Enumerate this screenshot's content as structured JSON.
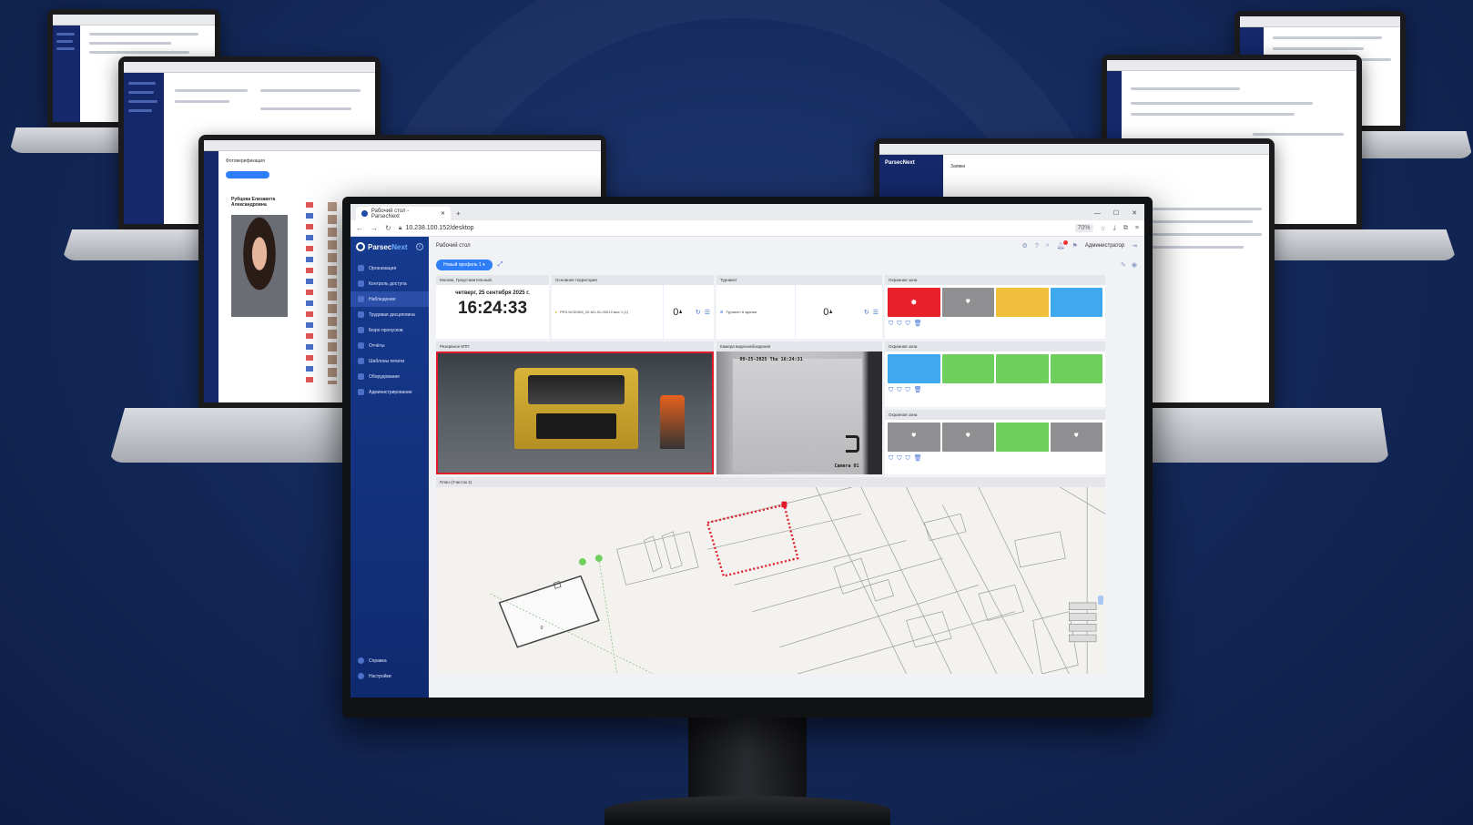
{
  "browser": {
    "tab_title": "Рабочий стол - ParsecNext",
    "url": "10.238.100.152/desktop",
    "zoom": "70%"
  },
  "app": {
    "brand_parsec": "Parsec",
    "brand_next": "Next",
    "page_title": "Рабочий стол",
    "user": "Администратор",
    "profile_label": "Новый профиль 1",
    "nav": [
      {
        "label": "Организация",
        "icon": "org-icon"
      },
      {
        "label": "Контроль доступа",
        "icon": "access-icon"
      },
      {
        "label": "Наблюдение",
        "icon": "eye-icon",
        "active": true
      },
      {
        "label": "Трудовая дисциплина",
        "icon": "worker-icon"
      },
      {
        "label": "Бюро пропусков",
        "icon": "pass-icon"
      },
      {
        "label": "Отчёты",
        "icon": "report-icon"
      },
      {
        "label": "Шаблоны печати",
        "icon": "print-icon"
      },
      {
        "label": "Оборудование",
        "icon": "hardware-icon"
      },
      {
        "label": "Администрирование",
        "icon": "admin-icon"
      }
    ],
    "nav_bottom": [
      {
        "label": "Справка",
        "icon": "help-icon"
      },
      {
        "label": "Настройки",
        "icon": "settings-icon"
      }
    ]
  },
  "widgets": {
    "clock": {
      "title": "Москва, Гредставительный.",
      "date": "четверг, 25 сентября 2025 г.",
      "time": "16:24:33"
    },
    "territory": {
      "title": "Основная территория",
      "device": "PRS.NC60KM_0Z-M1-01-00013 вых 1 (1)",
      "count": "0"
    },
    "turnstile": {
      "title": "Турникет",
      "device": "Турникет в здании",
      "count": "0"
    },
    "zones1": {
      "title": "Охранная зона",
      "colors": [
        "#e8202a",
        "#8f8f91",
        "#f0c03c",
        "#3fa9f0"
      ]
    },
    "zones2": {
      "title": "Охранная зона",
      "colors": [
        "#3fa9f0",
        "#6fcf5c",
        "#6fcf5c",
        "#6fcf5c"
      ]
    },
    "zones3": {
      "title": "Охранная зона",
      "colors": [
        "#8f8f91",
        "#8f8f91",
        "#6fcf5c",
        "#8f8f91"
      ]
    },
    "camera1": {
      "title": "Резервное КПП"
    },
    "camera2": {
      "title": "Камера видеонаблюдения",
      "osd_time": "09-25-2025 Thu 16:24:31",
      "osd_name": "Camera 01"
    },
    "map": {
      "title": "План (Участок 2)",
      "room_number": "0"
    }
  },
  "background": {
    "laptop_card_name": "Рубцова Елизавета Александровна",
    "laptop_title_left": "Фотоверификация",
    "laptop_title_right": "Заявки"
  }
}
